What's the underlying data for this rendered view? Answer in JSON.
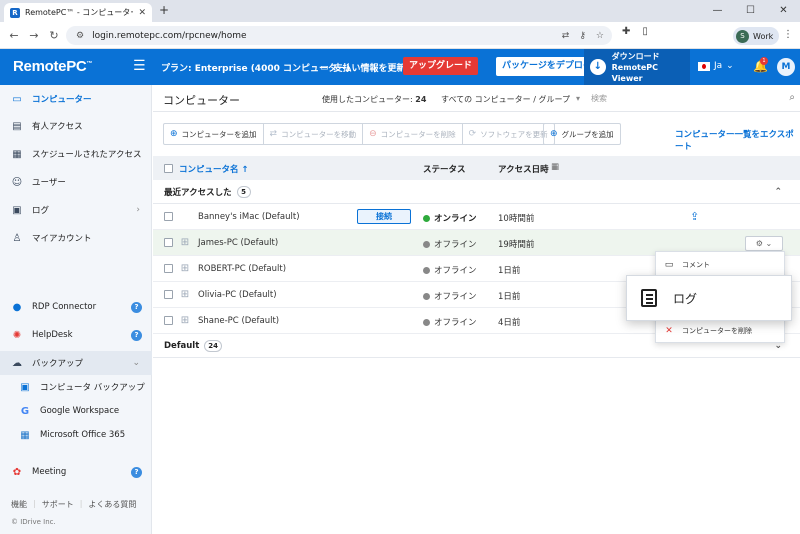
{
  "browser": {
    "tab_title": "RemotePC™ - コンピューター",
    "url": "login.remotepc.com/rpcnew/home",
    "profile_initial": "S",
    "profile_label": "Work"
  },
  "header": {
    "logo": "RemotePC",
    "plan": "プラン: Enterprise (4000 コンピューター)",
    "billing": "支払い情報を更新",
    "upgrade": "アップグレード",
    "deploy": "パッケージをデプロイ",
    "download_line1": "ダウンロード",
    "download_line2": "RemotePC Viewer",
    "language": "Ja",
    "notification_count": "1",
    "user_initial": "M"
  },
  "sidebar": {
    "items": [
      {
        "label": "コンピューター"
      },
      {
        "label": "有人アクセス"
      },
      {
        "label": "スケジュールされたアクセス"
      },
      {
        "label": "ユーザー"
      },
      {
        "label": "ログ"
      },
      {
        "label": "マイアカウント"
      }
    ],
    "rdp": "RDP Connector",
    "helpdesk": "HelpDesk",
    "backup": "バックアップ",
    "backup_sub": [
      "コンピュータ バックアップ",
      "Google Workspace",
      "Microsoft Office 365"
    ],
    "meeting": "Meeting",
    "footer": [
      "機能",
      "サポート",
      "よくある質問"
    ],
    "copyright": "© IDrive Inc."
  },
  "main": {
    "title": "コンピューター",
    "used_label": "使用したコンピューター:",
    "used_value": "24",
    "group_select": "すべての コンピューター / グループ",
    "search_placeholder": "検索",
    "toolbar": [
      "コンピューターを追加",
      "コンピューターを移動",
      "コンピューターを削除",
      "ソフトウェアを更新"
    ],
    "add_group": "グループを追加",
    "export": "コンピューター一覧をエクスポート",
    "columns": {
      "name": "コンピュータ名 ↑",
      "status": "ステータス",
      "access": "アクセス日時"
    },
    "recent_group": "最近アクセスした",
    "recent_count": "5",
    "default_group": "Default",
    "default_count": "24",
    "connect": "接続",
    "rows": [
      {
        "name": "Banney's iMac (Default)",
        "status": "オンライン",
        "access": "10時間前"
      },
      {
        "name": "James-PC (Default)",
        "status": "オフライン",
        "access": "19時間前"
      },
      {
        "name": "ROBERT-PC (Default)",
        "status": "オフライン",
        "access": "1日前"
      },
      {
        "name": "Olivia-PC (Default)",
        "status": "オフライン",
        "access": "1日前"
      },
      {
        "name": "Shane-PC (Default)",
        "status": "オフライン",
        "access": "4日前"
      }
    ]
  },
  "menu": {
    "comment": "コメント",
    "log": "ログ",
    "delete": "コンピューターを削除"
  }
}
